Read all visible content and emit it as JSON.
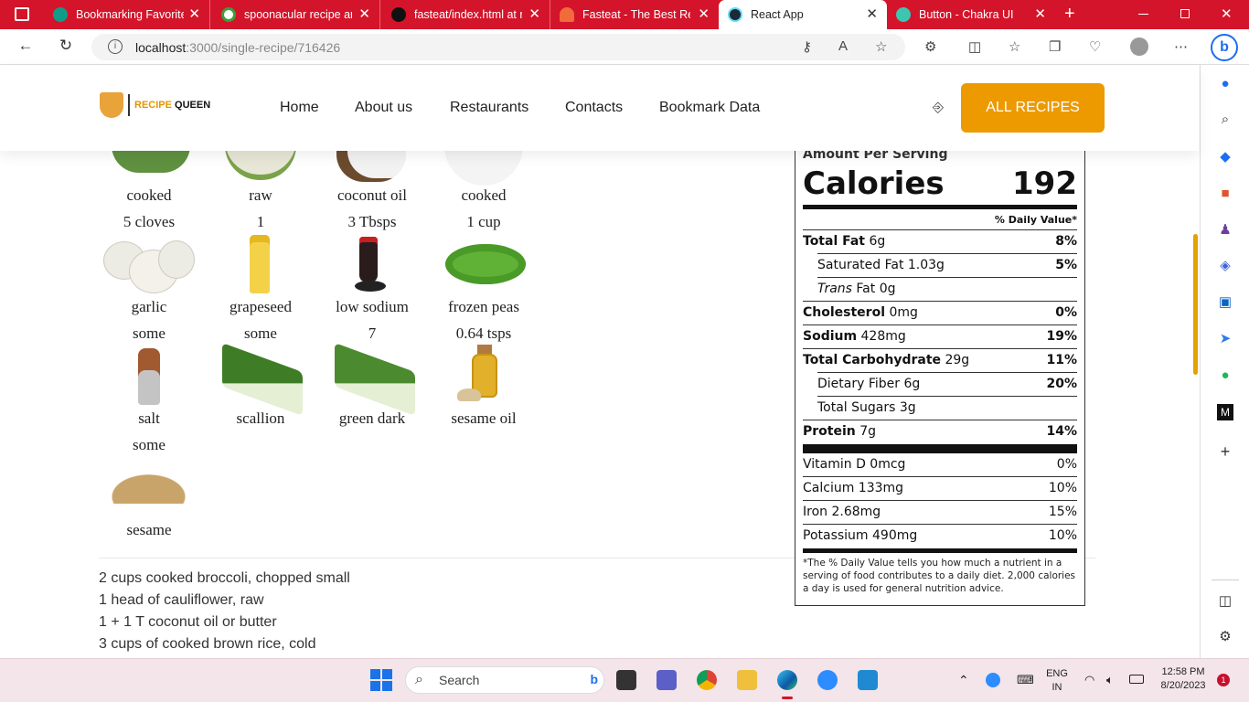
{
  "browser": {
    "tabs": [
      {
        "title": "Bookmarking Favorite",
        "color": "#0f9d8a"
      },
      {
        "title": "spoonacular recipe and",
        "color": "#3c9e3c"
      },
      {
        "title": "fasteat/index.html at m",
        "color": "#111111"
      },
      {
        "title": "Fasteat - The Best Rest",
        "color": "#f26b3a"
      },
      {
        "title": "React App",
        "color": "#1b2a33"
      },
      {
        "title": "Button - Chakra UI",
        "color": "#3cc6b0"
      }
    ],
    "url_host": "localhost",
    "url_path": ":3000/single-recipe/716426"
  },
  "header": {
    "logo_a": "RECIPE ",
    "logo_b": "QUEEN",
    "nav": [
      "Home",
      "About us",
      "Restaurants",
      "Contacts",
      "Bookmark Data"
    ],
    "cta": "ALL RECIPES"
  },
  "ingredients": [
    {
      "desc": "cooked",
      "amount": "5 cloves"
    },
    {
      "desc": "raw",
      "amount": "1"
    },
    {
      "desc": "coconut oil",
      "amount": "3 Tbsps"
    },
    {
      "desc": "cooked",
      "amount": "1 cup"
    },
    {
      "desc": "garlic",
      "amount": "some"
    },
    {
      "desc": "grapeseed",
      "amount": "some"
    },
    {
      "desc": "low sodium",
      "amount": "7"
    },
    {
      "desc": "frozen peas",
      "amount": "0.64 tsps"
    },
    {
      "desc": "salt",
      "amount": "some"
    },
    {
      "desc": "scallion",
      "amount": ""
    },
    {
      "desc": "green dark",
      "amount": ""
    },
    {
      "desc": "sesame oil",
      "amount": ""
    },
    {
      "desc": "sesame",
      "amount": ""
    }
  ],
  "instructions": [
    "2 cups cooked broccoli, chopped small",
    "1 head of cauliflower, raw",
    "1 + 1 T coconut oil or butter",
    "3 cups of cooked brown rice, cold"
  ],
  "nutrition": {
    "per_serving": "Amount Per Serving",
    "cal_label": "Calories",
    "cal_value": "192",
    "dv_header": "% Daily Value*",
    "rows": [
      {
        "name": "Total Fat",
        "amt": " 6g",
        "pct": "8%"
      },
      {
        "name": "Saturated Fat 1.03g",
        "amt": "",
        "pct": "5%"
      },
      {
        "name": "Trans",
        "amt": " Fat 0g",
        "pct": ""
      },
      {
        "name": "Cholesterol",
        "amt": " 0mg",
        "pct": "0%"
      },
      {
        "name": "Sodium",
        "amt": " 428mg",
        "pct": "19%"
      },
      {
        "name": "Total Carbohydrate",
        "amt": " 29g",
        "pct": "11%"
      },
      {
        "name": "Dietary Fiber 6g",
        "amt": "",
        "pct": "20%"
      },
      {
        "name": "Total Sugars 3g",
        "amt": "",
        "pct": ""
      },
      {
        "name": "Protein",
        "amt": " 7g",
        "pct": "14%"
      }
    ],
    "minerals": [
      {
        "name": "Vitamin D 0mcg",
        "pct": "0%"
      },
      {
        "name": "Calcium 133mg",
        "pct": "10%"
      },
      {
        "name": "Iron 2.68mg",
        "pct": "15%"
      },
      {
        "name": "Potassium 490mg",
        "pct": "10%"
      }
    ],
    "footnote": "*The % Daily Value tells you how much a nutrient in a serving of food contributes to a daily diet. 2,000 calories a day is used for general nutrition advice."
  },
  "taskbar": {
    "search": "Search",
    "lang1": "ENG",
    "lang2": "IN",
    "time": "12:58 PM",
    "date": "8/20/2023",
    "badge": "1"
  }
}
